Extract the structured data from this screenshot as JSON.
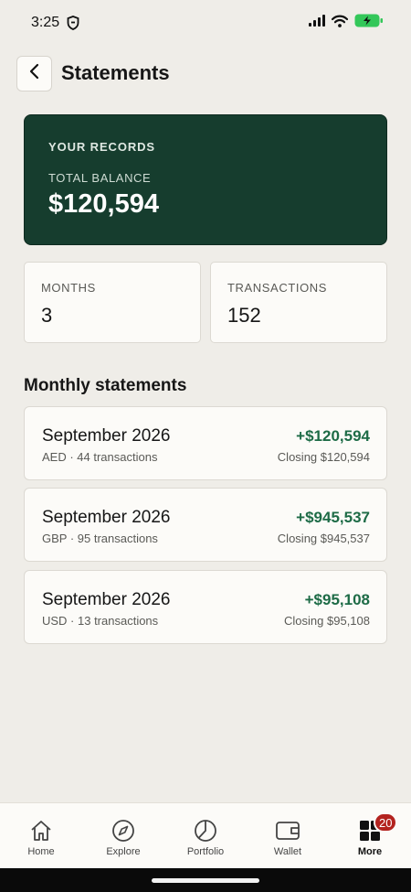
{
  "status_bar": {
    "time": "3:25"
  },
  "header": {
    "title": "Statements"
  },
  "hero": {
    "kicker": "YOUR RECORDS",
    "label": "TOTAL BALANCE",
    "value": "$120,594",
    "background": "#163d2e"
  },
  "stats": [
    {
      "label": "MONTHS",
      "value": "3"
    },
    {
      "label": "TRANSACTIONS",
      "value": "152"
    }
  ],
  "section": {
    "title": "Monthly statements"
  },
  "statements": [
    {
      "month": "September 2026",
      "subtitle": "AED · 44 transactions",
      "amount": "+$120,594",
      "closing": "Closing $120,594"
    },
    {
      "month": "September 2026",
      "subtitle": "GBP · 95 transactions",
      "amount": "+$945,537",
      "closing": "Closing $945,537"
    },
    {
      "month": "September 2026",
      "subtitle": "USD · 13 transactions",
      "amount": "+$95,108",
      "closing": "Closing $95,108"
    }
  ],
  "nav": {
    "items": [
      {
        "label": "Home",
        "icon": "home-icon"
      },
      {
        "label": "Explore",
        "icon": "compass-icon"
      },
      {
        "label": "Portfolio",
        "icon": "pie-chart-icon"
      },
      {
        "label": "Wallet",
        "icon": "wallet-icon"
      },
      {
        "label": "More",
        "icon": "grid-icon",
        "badge": "20",
        "active": true
      }
    ]
  },
  "colors": {
    "accent_green": "#1d6b46",
    "badge_red": "#b3231f",
    "background": "#efede8"
  }
}
